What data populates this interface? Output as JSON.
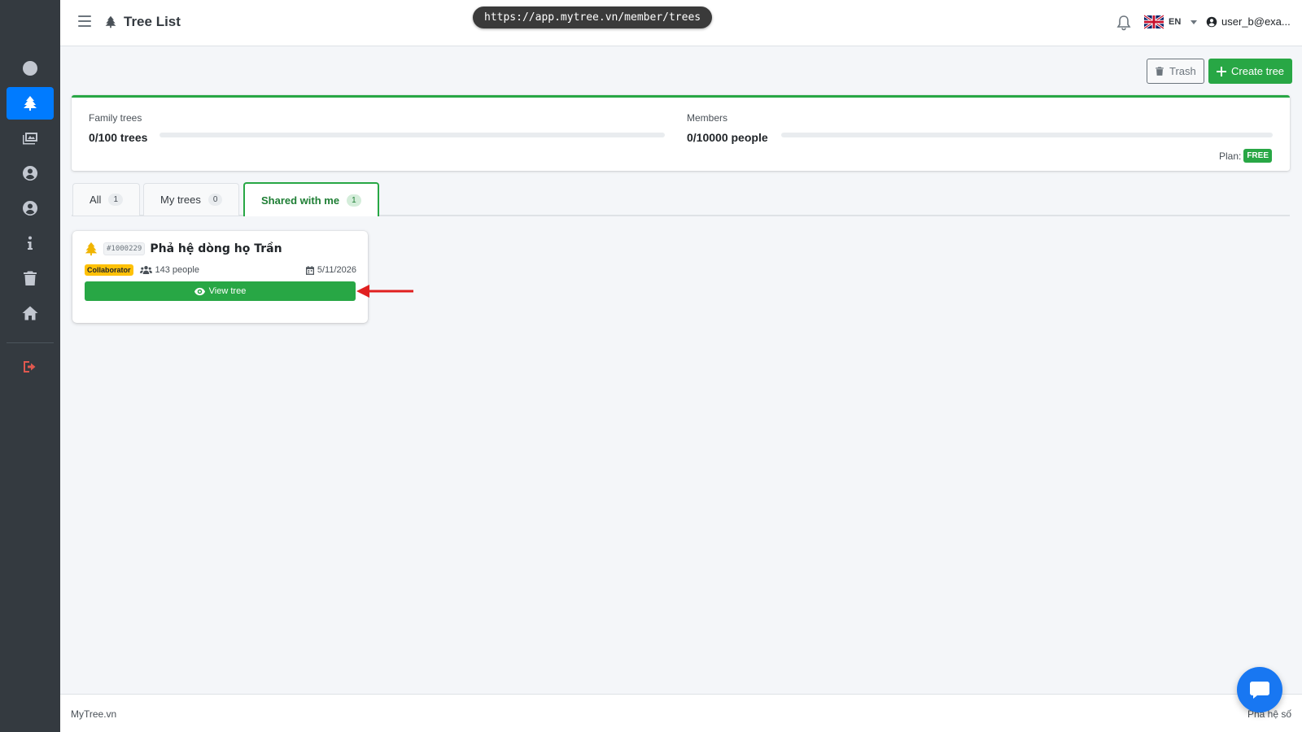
{
  "navbar": {
    "title": "Tree List",
    "url": "https://app.mytree.vn/member/trees",
    "language": "EN",
    "user": "user_b@exa..."
  },
  "sidebar": {
    "items": [
      {
        "icon": "circle-icon"
      },
      {
        "icon": "tree-icon",
        "active": true
      },
      {
        "icon": "images-icon"
      },
      {
        "icon": "user-circle-icon"
      },
      {
        "icon": "user-circle-icon"
      },
      {
        "icon": "info-icon"
      },
      {
        "icon": "trash-icon"
      },
      {
        "icon": "home-icon"
      },
      {
        "icon": "logout-icon"
      }
    ]
  },
  "toolbar": {
    "trash_label": "Trash",
    "create_label": "Create tree"
  },
  "stats": {
    "family_trees_label": "Family trees",
    "family_trees_value": "0/100 trees",
    "family_trees_fraction": 0,
    "members_label": "Members",
    "members_value": "0/10000 people",
    "members_fraction": 0,
    "plan_label": "Plan:",
    "plan_value": "FREE"
  },
  "tabs": [
    {
      "label": "All",
      "count": "1"
    },
    {
      "label": "My trees",
      "count": "0"
    },
    {
      "label": "Shared with me",
      "count": "1",
      "active": true
    }
  ],
  "tree_card": {
    "id": "#1000229",
    "name": "Phả hệ dòng họ Trần",
    "role": "Collaborator",
    "people": "143 people",
    "date": "5/11/2026",
    "view_label": "View tree"
  },
  "footer": {
    "left": "MyTree.vn",
    "right": "Phả hệ số"
  },
  "colors": {
    "sidebar_bg": "#343a40",
    "sidebar_active": "#007bff",
    "success": "#28a745",
    "warning": "#ffc107",
    "chat": "#1877f2",
    "annotation_arrow": "#e02020"
  }
}
